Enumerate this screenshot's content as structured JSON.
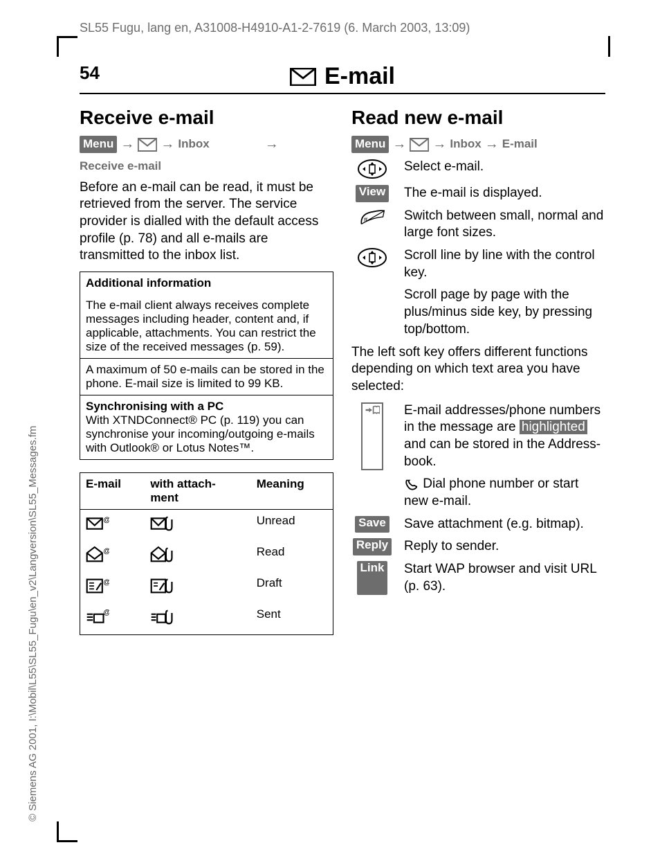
{
  "header": "SL55 Fugu, lang en, A31008-H4910-A1-2-7619 (6. March 2003, 13:09)",
  "side": "© Siemens AG 2001, I:\\Mobil\\L55\\SL55_Fugu\\en_v2\\Langversion\\SL55_Messages.fm",
  "pagenum": "54",
  "title": "E-mail",
  "left": {
    "h2": "Receive e-mail",
    "nav": {
      "menu": "Menu",
      "inbox": "Inbox",
      "receive": "Receive e-mail"
    },
    "para": "Before an e-mail can be read, it must be retrieved from the server. The service provider is dialled with the default access profile (p. 78) and all e-mails are transmitted to the inbox list.",
    "info_title": "Additional information",
    "info1": "The e-mail client always receives complete messages including header, content and, if applicable, attachments. You can restrict the size of the received messages (p. 59).",
    "info2": "A maximum of 50 e-mails can be stored in the phone. E-mail size is limited to 99 KB.",
    "sync_title": "Synchronising with a PC",
    "sync": "With XTNDConnect® PC (p. 119) you can synchronise your incoming/outgoing e-mails with Outlook® or Lotus Notes™.",
    "table": {
      "headers": [
        "E-mail",
        "with attach-\nment",
        "Meaning"
      ],
      "rows": [
        {
          "m": "Unread"
        },
        {
          "m": "Read"
        },
        {
          "m": "Draft"
        },
        {
          "m": "Sent"
        }
      ]
    }
  },
  "right": {
    "h2": "Read new e-mail",
    "nav": {
      "menu": "Menu",
      "inbox": "Inbox",
      "email": "E-mail"
    },
    "r1": "Select e-mail.",
    "view": "View",
    "r2": "The e-mail is displayed.",
    "r3": "Switch between small, normal and large font sizes.",
    "r4": "Scroll line by line with the control key.",
    "r5": "Scroll page by page with the plus/minus side key, by pressing top/bottom.",
    "para": "The left soft key offers different functions depending on which text area you have selected:",
    "addr1": "E-mail addresses/phone numbers in the message are ",
    "addr_hl": "highlighted",
    "addr2": " and can be stored in the Address-book.",
    "dial": "Dial phone number or start new e-mail.",
    "save": "Save",
    "save_desc": "Save attachment (e.g. bitmap).",
    "reply": "Reply",
    "reply_desc": "Reply to sender.",
    "link": "Link",
    "link_desc": "Start WAP browser and visit URL (p. 63)."
  }
}
